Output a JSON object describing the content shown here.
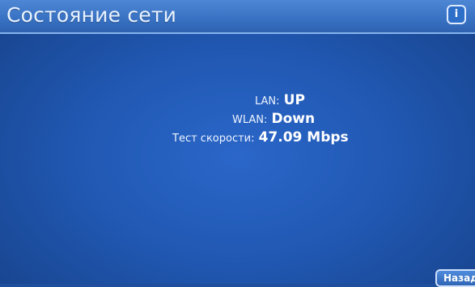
{
  "header": {
    "title": "Состояние сети",
    "info_label": "i"
  },
  "status": {
    "lan_label": "LAN:",
    "lan_value": "UP",
    "wlan_label": "WLAN:",
    "wlan_value": "Down",
    "speed_label": "Тест скорости:",
    "speed_value": "47.09 Mbps"
  },
  "footer": {
    "back_label": "Назад"
  },
  "colors": {
    "background": "#2159b4",
    "header": "#3a73c4",
    "text": "#ffffff"
  }
}
